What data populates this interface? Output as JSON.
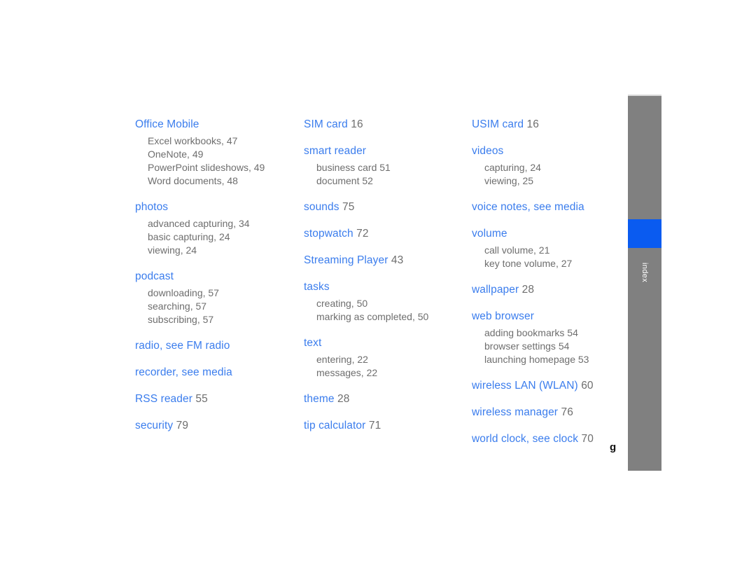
{
  "page": {
    "folio": "g",
    "background_color": "#ffffff",
    "heading_color": "#3b7ded",
    "sub_entry_color": "#6e6e6e"
  },
  "sidebar": {
    "label": "index",
    "bar_color": "#808080",
    "active_color": "#0a5bf0",
    "label_color": "#ffffff"
  },
  "columns": [
    {
      "name": "column-1",
      "groups": [
        {
          "heading": "Office Mobile",
          "page": "",
          "sub_entries": [
            "Excel workbooks, 47",
            "OneNote, 49",
            "PowerPoint slideshows, 49",
            "Word documents, 48"
          ]
        },
        {
          "heading": "photos",
          "page": "",
          "sub_entries": [
            "advanced capturing, 34",
            "basic capturing, 24",
            "viewing, 24"
          ]
        },
        {
          "heading": "podcast",
          "page": "",
          "sub_entries": [
            "downloading, 57",
            "searching, 57",
            "subscribing, 57"
          ]
        },
        {
          "heading": "radio, see FM radio",
          "page": "",
          "sub_entries": []
        },
        {
          "heading": "recorder, see media",
          "page": "",
          "sub_entries": []
        },
        {
          "heading": "RSS reader",
          "page": "55",
          "sub_entries": []
        },
        {
          "heading": "security",
          "page": "79",
          "sub_entries": []
        }
      ]
    },
    {
      "name": "column-2",
      "groups": [
        {
          "heading": "SIM card",
          "page": "16",
          "sub_entries": []
        },
        {
          "heading": "smart reader",
          "page": "",
          "sub_entries": [
            "business card 51",
            "document 52"
          ]
        },
        {
          "heading": "sounds",
          "page": "75",
          "sub_entries": []
        },
        {
          "heading": "stopwatch",
          "page": "72",
          "sub_entries": []
        },
        {
          "heading": "Streaming Player",
          "page": "43",
          "sub_entries": []
        },
        {
          "heading": "tasks",
          "page": "",
          "sub_entries": [
            "creating, 50",
            "marking as completed, 50"
          ]
        },
        {
          "heading": "text",
          "page": "",
          "sub_entries": [
            "entering, 22",
            "messages, 22"
          ]
        },
        {
          "heading": "theme",
          "page": "28",
          "sub_entries": []
        },
        {
          "heading": "tip calculator",
          "page": "71",
          "sub_entries": []
        }
      ]
    },
    {
      "name": "column-3",
      "groups": [
        {
          "heading": "USIM card",
          "page": "16",
          "sub_entries": []
        },
        {
          "heading": "videos",
          "page": "",
          "sub_entries": [
            "capturing, 24",
            "viewing, 25"
          ]
        },
        {
          "heading": "voice notes, see media",
          "page": "",
          "sub_entries": []
        },
        {
          "heading": "volume",
          "page": "",
          "sub_entries": [
            "call volume, 21",
            "key tone volume, 27"
          ]
        },
        {
          "heading": "wallpaper",
          "page": "28",
          "sub_entries": []
        },
        {
          "heading": "web browser",
          "page": "",
          "sub_entries": [
            "adding bookmarks 54",
            "browser settings 54",
            "launching homepage 53"
          ]
        },
        {
          "heading": "wireless LAN (WLAN)",
          "page": "60",
          "sub_entries": []
        },
        {
          "heading": "wireless manager",
          "page": "76",
          "sub_entries": []
        },
        {
          "heading": "world clock, see clock",
          "page": "70",
          "sub_entries": []
        }
      ]
    }
  ]
}
